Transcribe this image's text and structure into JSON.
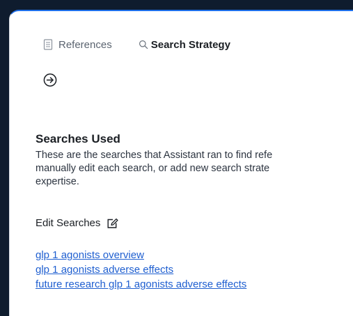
{
  "tabs": [
    {
      "label": "References",
      "icon": "document-icon",
      "active": false
    },
    {
      "label": "Search Strategy",
      "icon": "search-icon",
      "active": true
    }
  ],
  "next_button": {
    "icon": "arrow-circle-right-icon"
  },
  "section": {
    "title": "Searches Used",
    "description": "These are the searches that Assistant ran to find refe\nmanually edit each search, or add new search strate\nexpertise."
  },
  "edit": {
    "label": "Edit Searches",
    "icon": "edit-icon"
  },
  "searches": [
    "glp 1 agonists overview",
    "glp 1 agonists adverse effects",
    "future research glp 1 agonists adverse effects"
  ],
  "colors": {
    "accent": "#1f6feb",
    "link": "#1f5fd0",
    "background": "#0f1c2e",
    "panel": "#ffffff"
  }
}
